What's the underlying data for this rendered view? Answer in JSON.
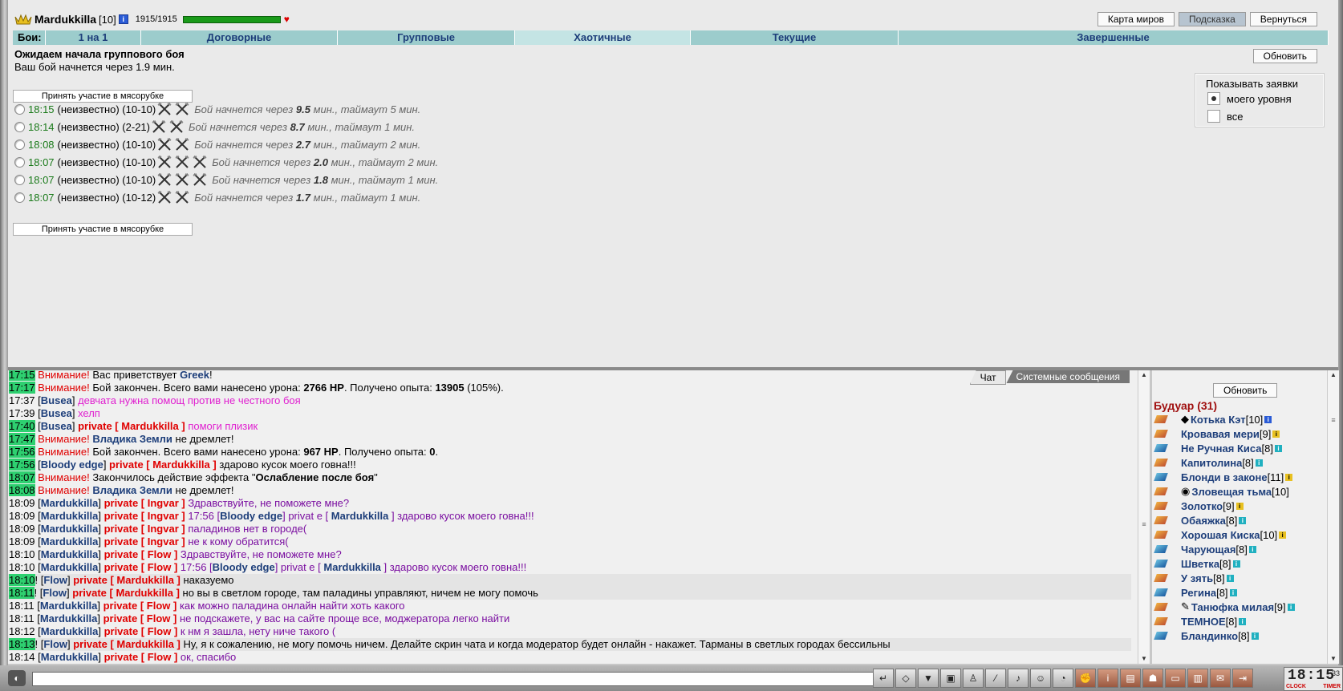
{
  "player": {
    "name": "Mardukkilla",
    "level": "[10]",
    "hp": "1915/1915",
    "hp_fraction": 1.0
  },
  "top_buttons": [
    "Карта миров",
    "Подсказка",
    "Вернуться"
  ],
  "tabs": {
    "label": "Бои:",
    "items": [
      "1 на 1",
      "Договорные",
      "Групповые",
      "Хаотичные",
      "Текущие",
      "Завершенные"
    ],
    "selected": "Хаотичные"
  },
  "status": {
    "title": "Ожидаем начала группового боя",
    "subtitle": "Ваш бой начнется через 1.9 мин."
  },
  "refresh_label": "Обновить",
  "join_label": "Принять участие в мясорубке",
  "fights": [
    {
      "time": "18:15",
      "who": "(неизвестно)",
      "range": "(10-10)",
      "swords": 2,
      "pre": "Бой начнется через",
      "val": "9.5",
      "post": "мин., таймаут 5 мин."
    },
    {
      "time": "18:14",
      "who": "(неизвестно)",
      "range": "(2-21)",
      "swords": 2,
      "pre": "Бой начнется через",
      "val": "8.7",
      "post": "мин., таймаут 1 мин."
    },
    {
      "time": "18:08",
      "who": "(неизвестно)",
      "range": "(10-10)",
      "swords": 2,
      "pre": "Бой начнется через",
      "val": "2.7",
      "post": "мин., таймаут 2 мин."
    },
    {
      "time": "18:07",
      "who": "(неизвестно)",
      "range": "(10-10)",
      "swords": 3,
      "pre": "Бой начнется через",
      "val": "2.0",
      "post": "мин., таймаут 2 мин."
    },
    {
      "time": "18:07",
      "who": "(неизвестно)",
      "range": "(10-10)",
      "swords": 3,
      "pre": "Бой начнется через",
      "val": "1.8",
      "post": "мин., таймаут 1 мин."
    },
    {
      "time": "18:07",
      "who": "(неизвестно)",
      "range": "(10-12)",
      "swords": 2,
      "pre": "Бой начнется через",
      "val": "1.7",
      "post": "мин., таймаут 1 мин."
    }
  ],
  "filter": {
    "title": "Показывать заявки",
    "options": [
      "моего уровня",
      "все"
    ],
    "selected": 0
  },
  "chat_tabs": [
    "Чат",
    "Системные сообщения"
  ],
  "chat": [
    {
      "time": "17:15",
      "g": true,
      "parts": [
        [
          "warn",
          "Внимание!"
        ],
        [
          "",
          " Вас приветствует "
        ],
        [
          "nm",
          "Greek"
        ],
        [
          "",
          "!"
        ]
      ]
    },
    {
      "time": "17:17",
      "g": true,
      "parts": [
        [
          "warn",
          "Внимание!"
        ],
        [
          "",
          " Бой закончен. Всего вами нанесено урона: "
        ],
        [
          "b",
          "2766 HP"
        ],
        [
          "",
          ". Получено опыта: "
        ],
        [
          "b",
          "13905"
        ],
        [
          "",
          " (105%)."
        ]
      ]
    },
    {
      "time": "17:37",
      "g": false,
      "parts": [
        [
          "",
          "["
        ],
        [
          "nm",
          "Busea"
        ],
        [
          "",
          "] "
        ],
        [
          "pink",
          "девчата нужна помощ против не честного боя"
        ]
      ]
    },
    {
      "time": "17:39",
      "g": false,
      "parts": [
        [
          "",
          "["
        ],
        [
          "nm",
          "Busea"
        ],
        [
          "",
          "] "
        ],
        [
          "pink",
          "хелп"
        ]
      ]
    },
    {
      "time": "17:40",
      "g": true,
      "parts": [
        [
          "",
          "["
        ],
        [
          "nm",
          "Busea"
        ],
        [
          "",
          "] "
        ],
        [
          "pv",
          "private [ Mardukkilla ]"
        ],
        [
          "pink",
          " помоги плизик"
        ]
      ]
    },
    {
      "time": "17:47",
      "g": true,
      "parts": [
        [
          "warn",
          "Внимание!"
        ],
        [
          "",
          " "
        ],
        [
          "nm",
          "Владика Земли"
        ],
        [
          "",
          " не дремлет!"
        ]
      ]
    },
    {
      "time": "17:56",
      "g": true,
      "parts": [
        [
          "warn",
          "Внимание!"
        ],
        [
          "",
          " Бой закончен. Всего вами нанесено урона: "
        ],
        [
          "b",
          "967 HP"
        ],
        [
          "",
          ". Получено опыта: "
        ],
        [
          "b",
          "0"
        ],
        [
          "",
          "."
        ]
      ]
    },
    {
      "time": "17:56",
      "g": true,
      "parts": [
        [
          "",
          "["
        ],
        [
          "nm",
          "Bloody edge"
        ],
        [
          "",
          "] "
        ],
        [
          "pv",
          "private [ Mardukkilla ]"
        ],
        [
          "",
          " здарово кусок моего говна!!!"
        ]
      ]
    },
    {
      "time": "18:07",
      "g": true,
      "parts": [
        [
          "warn",
          "Внимание!"
        ],
        [
          "",
          " Закончилось действие эффекта \""
        ],
        [
          "b",
          "Ослабление после боя"
        ],
        [
          "",
          "\""
        ]
      ]
    },
    {
      "time": "18:08",
      "g": true,
      "parts": [
        [
          "warn",
          "Внимание!"
        ],
        [
          "",
          " "
        ],
        [
          "nm",
          "Владика Земли"
        ],
        [
          "",
          " не дремлет!"
        ]
      ]
    },
    {
      "time": "18:09",
      "g": false,
      "parts": [
        [
          "",
          "["
        ],
        [
          "nm",
          "Mardukkilla"
        ],
        [
          "",
          "] "
        ],
        [
          "pv",
          "private [ Ingvar ]"
        ],
        [
          "purp",
          " Здравствуйте, не поможете мне?"
        ]
      ]
    },
    {
      "time": "18:09",
      "g": false,
      "parts": [
        [
          "",
          "["
        ],
        [
          "nm",
          "Mardukkilla"
        ],
        [
          "",
          "] "
        ],
        [
          "pv",
          "private [ Ingvar ]"
        ],
        [
          "purp",
          " 17:56 ["
        ],
        [
          "nm",
          "Bloody edge"
        ],
        [
          "purp",
          "] privat e [ "
        ],
        [
          "nm",
          "Mardukkilla"
        ],
        [
          "purp",
          " ] здарово кусок моего говна!!!"
        ]
      ]
    },
    {
      "time": "18:09",
      "g": false,
      "parts": [
        [
          "",
          "["
        ],
        [
          "nm",
          "Mardukkilla"
        ],
        [
          "",
          "] "
        ],
        [
          "pv",
          "private [ Ingvar ]"
        ],
        [
          "purp",
          " паладинов нет в городе("
        ]
      ]
    },
    {
      "time": "18:09",
      "g": false,
      "parts": [
        [
          "",
          "["
        ],
        [
          "nm",
          "Mardukkilla"
        ],
        [
          "",
          "] "
        ],
        [
          "pv",
          "private [ Ingvar ]"
        ],
        [
          "purp",
          " не к кому обратится("
        ]
      ]
    },
    {
      "time": "18:10",
      "g": false,
      "parts": [
        [
          "",
          "["
        ],
        [
          "nm",
          "Mardukkilla"
        ],
        [
          "",
          "] "
        ],
        [
          "pv",
          "private [ Flow ]"
        ],
        [
          "purp",
          " Здравствуйте, не поможете мне?"
        ]
      ]
    },
    {
      "time": "18:10",
      "g": false,
      "parts": [
        [
          "",
          "["
        ],
        [
          "nm",
          "Mardukkilla"
        ],
        [
          "",
          "] "
        ],
        [
          "pv",
          "private [ Flow ]"
        ],
        [
          "purp",
          " 17:56 ["
        ],
        [
          "nm",
          "Bloody edge"
        ],
        [
          "purp",
          "] privat e [ "
        ],
        [
          "nm",
          "Mardukkilla"
        ],
        [
          "purp",
          " ] здарово кусок моего говна!!!"
        ]
      ]
    },
    {
      "time": "18:10",
      "g": true,
      "hl": true,
      "parts": [
        [
          "",
          "! ["
        ],
        [
          "nm",
          "Flow"
        ],
        [
          "",
          "] "
        ],
        [
          "pv",
          "private [ Mardukkilla ]"
        ],
        [
          "",
          " наказуемо"
        ]
      ]
    },
    {
      "time": "18:11",
      "g": true,
      "hl": true,
      "parts": [
        [
          "",
          "! ["
        ],
        [
          "nm",
          "Flow"
        ],
        [
          "",
          "] "
        ],
        [
          "pv",
          "private [ Mardukkilla ]"
        ],
        [
          "",
          " но вы в светлом городе, там паладины управляют, ничем не могу помочь"
        ]
      ]
    },
    {
      "time": "18:11",
      "g": false,
      "parts": [
        [
          "",
          "["
        ],
        [
          "nm",
          "Mardukkilla"
        ],
        [
          "",
          "] "
        ],
        [
          "pv",
          "private [ Flow ]"
        ],
        [
          "purp",
          " как можно паладина онлайн найти хоть какого"
        ]
      ]
    },
    {
      "time": "18:11",
      "g": false,
      "parts": [
        [
          "",
          "["
        ],
        [
          "nm",
          "Mardukkilla"
        ],
        [
          "",
          "] "
        ],
        [
          "pv",
          "private [ Flow ]"
        ],
        [
          "purp",
          " не подскажете, у вас на сайте проще все, моджератора легко найти"
        ]
      ]
    },
    {
      "time": "18:12",
      "g": false,
      "parts": [
        [
          "",
          "["
        ],
        [
          "nm",
          "Mardukkilla"
        ],
        [
          "",
          "] "
        ],
        [
          "pv",
          "private [ Flow ]"
        ],
        [
          "purp",
          " к нм я зашла, нету ниче такого ("
        ]
      ]
    },
    {
      "time": "18:13",
      "g": true,
      "hl": true,
      "parts": [
        [
          "",
          "! ["
        ],
        [
          "nm",
          "Flow"
        ],
        [
          "",
          "] "
        ],
        [
          "pv",
          "private [ Mardukkilla ]"
        ],
        [
          "",
          " Ну, я к сожалению, не могу помочь ничем. Делайте скрин чата и когда модератор будет онлайн - накажет. Тарманы в светлых городах бессильны"
        ]
      ]
    },
    {
      "time": "18:14",
      "g": false,
      "parts": [
        [
          "",
          "["
        ],
        [
          "nm",
          "Mardukkilla"
        ],
        [
          "",
          "] "
        ],
        [
          "pv",
          "private [ Flow ]"
        ],
        [
          "purp",
          " ок, спасибо"
        ]
      ]
    }
  ],
  "room": "Будуар (31)",
  "users": [
    {
      "name": "Котька Кэт",
      "lvl": "[10]",
      "inf": "bl",
      "ava": "◆",
      "b": false
    },
    {
      "name": "Кровавая мери",
      "lvl": "[9]",
      "inf": "yl",
      "ava": "",
      "b": false
    },
    {
      "name": "Не Ручная Киса",
      "lvl": "[8]",
      "inf": "tl",
      "ava": "",
      "b": true
    },
    {
      "name": "Капитолина",
      "lvl": "[8]",
      "inf": "tl",
      "ava": "",
      "b": false
    },
    {
      "name": "Блонди в законе",
      "lvl": "[11]",
      "inf": "yl",
      "ava": "",
      "b": true
    },
    {
      "name": "Зловещая тьма",
      "lvl": "[10]",
      "inf": "",
      "ava": "◉",
      "b": false
    },
    {
      "name": "Золотко",
      "lvl": "[9]",
      "inf": "yl",
      "ava": "",
      "b": false
    },
    {
      "name": "Обаяжка",
      "lvl": "[8]",
      "inf": "tl",
      "ava": "",
      "b": false
    },
    {
      "name": "Хорошая Киска",
      "lvl": "[10]",
      "inf": "yl",
      "ava": "",
      "b": false
    },
    {
      "name": "Чарующая",
      "lvl": "[8]",
      "inf": "tl",
      "ava": "",
      "b": true
    },
    {
      "name": "Шветка",
      "lvl": "[8]",
      "inf": "tl",
      "ava": "",
      "b": true
    },
    {
      "name": "У зять",
      "lvl": "[8]",
      "inf": "tl",
      "ava": "",
      "b": false
    },
    {
      "name": "Регина",
      "lvl": "[8]",
      "inf": "tl",
      "ava": "",
      "b": true
    },
    {
      "name": "Танюфка милая",
      "lvl": "[9]",
      "inf": "tl",
      "ava": "✎",
      "b": false
    },
    {
      "name": "ТЕМНОЕ",
      "lvl": "[8]",
      "inf": "tl",
      "ava": "",
      "b": false
    },
    {
      "name": "Бландинко",
      "lvl": "[8]",
      "inf": "tl",
      "ava": "",
      "b": true
    }
  ],
  "toolbar_icons": [
    "enter-icon",
    "eraser-icon",
    "filter-icon",
    "save-icon",
    "walk-icon",
    "slash-icon",
    "sound-icon",
    "smile-icon",
    "helmet-icon",
    "fist-icon",
    "info-icon",
    "map-icon",
    "group-icon",
    "chest-icon",
    "lock-icon",
    "mail-icon",
    "exit-icon"
  ],
  "clock": {
    "time": "18:15",
    "sec": "33",
    "left": "CLOCK",
    "right": "TIMER"
  }
}
